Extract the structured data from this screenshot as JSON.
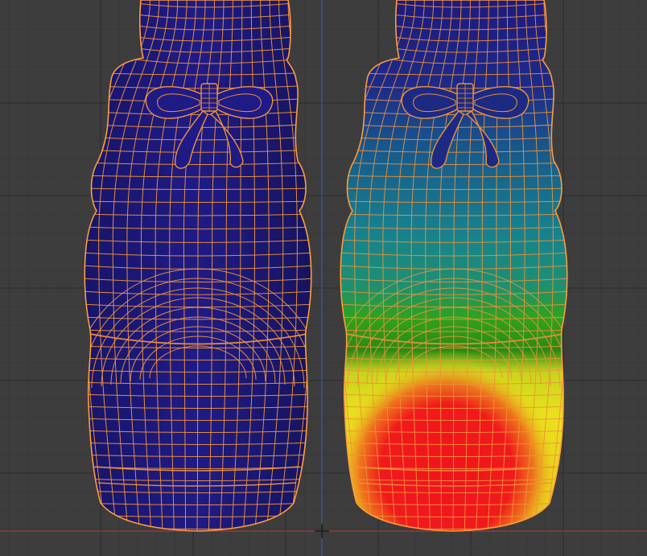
{
  "viewport": {
    "mode": "weight-paint",
    "grid_visible": true,
    "colors": {
      "background": "#3d3d3d",
      "grid_minor": "#353535",
      "grid_major": "#2c2c2c",
      "axis_x": "#b33b45",
      "axis_z": "#3a64b6",
      "wire": "#f0913a",
      "wire_edge": "#ff9c3c",
      "weight_zero": "#1d1a80",
      "weight_low": "#1a8a8f",
      "weight_mid": "#2fa21c",
      "weight_high": "#e8e21c",
      "weight_full": "#f0141c"
    }
  },
  "objects": [
    {
      "name": "left-boot",
      "selected": true,
      "weighted": false
    },
    {
      "name": "right-boot",
      "selected": true,
      "weighted": true
    }
  ],
  "cursor": {
    "icon": "crosshair-icon"
  }
}
